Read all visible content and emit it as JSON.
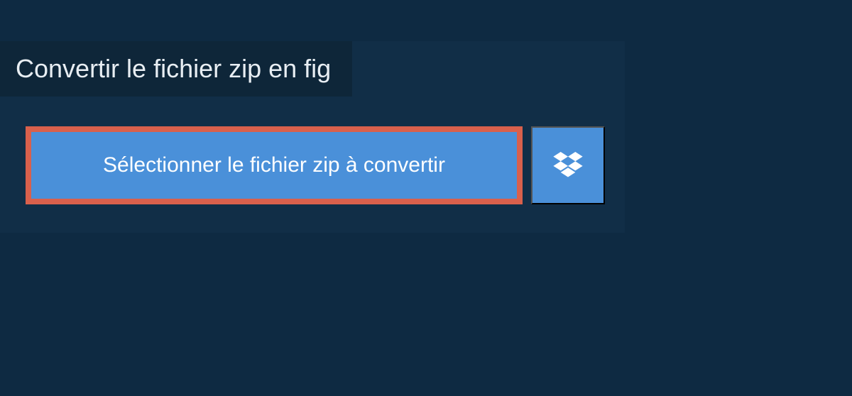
{
  "tab": {
    "title": "Convertir le fichier zip en fig"
  },
  "buttons": {
    "select_label": "Sélectionner le fichier zip à convertir"
  }
}
